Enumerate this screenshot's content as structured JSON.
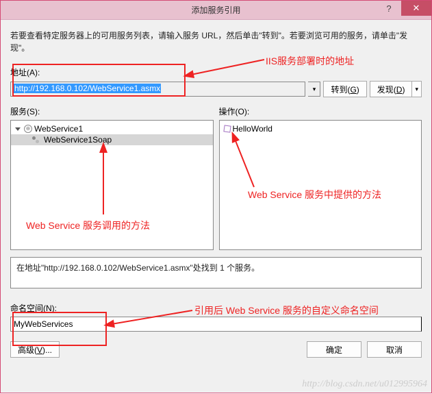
{
  "title": "添加服务引用",
  "instruction": "若要查看特定服务器上的可用服务列表，请输入服务 URL，然后单击\"转到\"。若要浏览可用的服务，请单击\"发现\"。",
  "address": {
    "label": "地址(A):",
    "value": "http://192.168.0.102/WebService1.asmx"
  },
  "buttons": {
    "go": "转到(G)",
    "discover": "发现(D)",
    "advanced": "高级(V)...",
    "ok": "确定",
    "cancel": "取消"
  },
  "services": {
    "label": "服务(S):",
    "root": "WebService1",
    "item": "WebService1Soap"
  },
  "operations": {
    "label": "操作(O):",
    "item": "HelloWorld"
  },
  "status": "在地址\"http://192.168.0.102/WebService1.asmx\"处找到 1 个服务。",
  "namespace": {
    "label": "命名空间(N):",
    "value": "MyWebServices"
  },
  "annotations": {
    "a1": "IIS服务部署时的地址",
    "a2": "Web Service 服务调用的方法",
    "a3": "Web Service 服务中提供的方法",
    "a4": "引用后 Web Service 服务的自定义命名空间"
  },
  "watermark": "http://blog.csdn.net/u012995964"
}
